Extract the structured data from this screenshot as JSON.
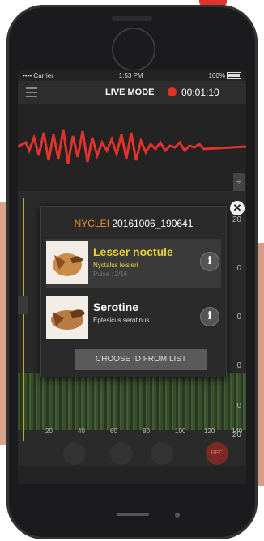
{
  "status_bar": {
    "carrier": "•••• Carrier",
    "time": "1:53 PM",
    "battery": "100%"
  },
  "header": {
    "title": "LIVE MODE",
    "timer": "00:01:10",
    "accent": "#e0332a"
  },
  "modal": {
    "prefix": "NYCLEI",
    "recording": "20161006_190641",
    "prefix_color": "#ef8a2a",
    "candidates": [
      {
        "name": "Lesser noctule",
        "scientific": "Nyctalus leisleri",
        "pulse": "Pulse : 2/16",
        "name_color": "#e8d13a",
        "info_icon": "info-icon"
      },
      {
        "name": "Serotine",
        "scientific": "Eptesicus serotinus",
        "pulse": "",
        "name_color": "#ffffff",
        "info_icon": "info-icon"
      }
    ],
    "choose_button": "CHOOSE ID FROM LIST",
    "close_icon": "close-icon"
  },
  "spectrogram": {
    "y_labels": [
      "20",
      "0",
      "0",
      "0",
      "0",
      "20"
    ],
    "x_labels": [
      "20",
      "40",
      "60",
      "80",
      "100",
      "120",
      "140"
    ]
  },
  "controls": {
    "record_label": "REC"
  }
}
